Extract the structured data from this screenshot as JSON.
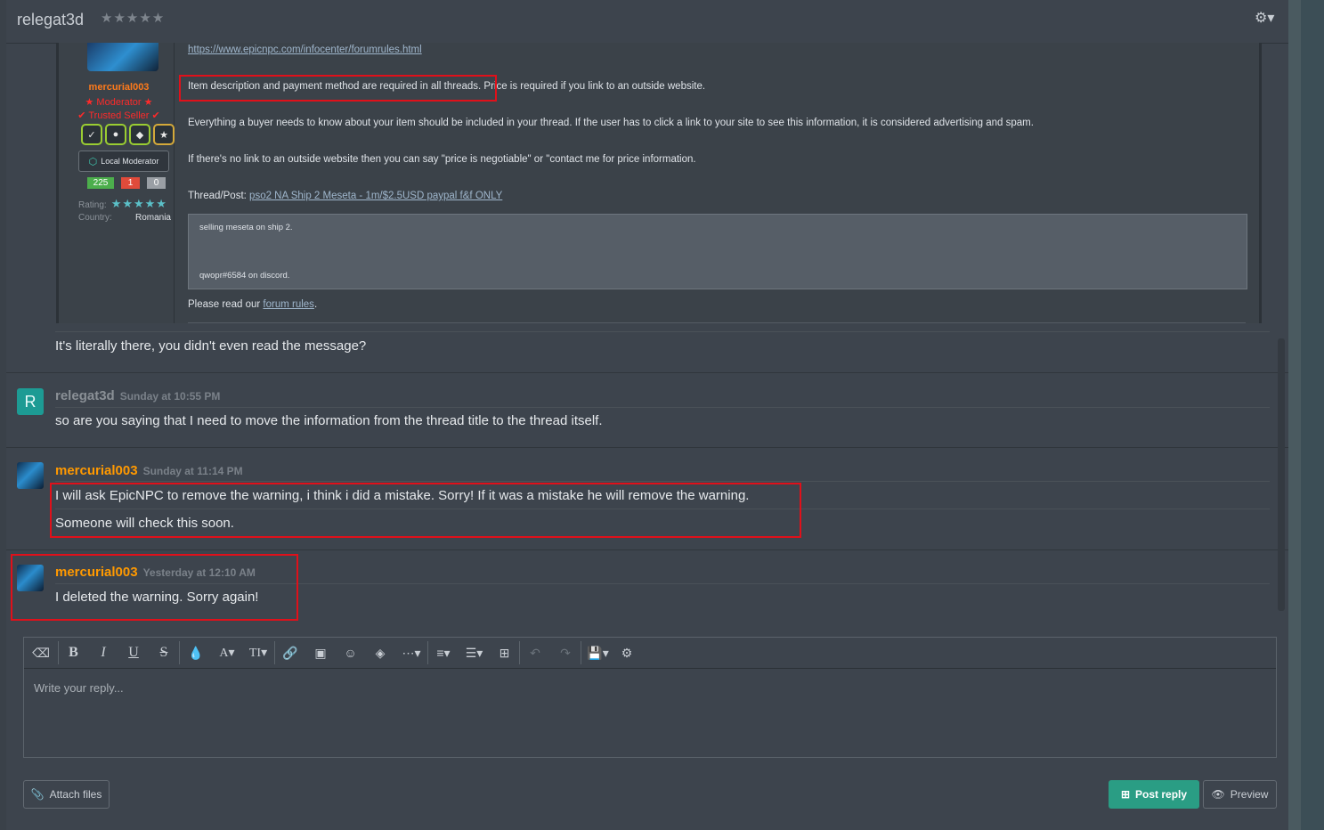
{
  "header": {
    "title": "relegat3d",
    "stars": "★★★★★",
    "gear_icon": "gear-icon"
  },
  "quote_user": {
    "name": "mercurial003",
    "role1": "★ Moderator ★",
    "role2": "✔ Trusted Seller ✔",
    "badge_text": "Local Moderator",
    "count_pos": "225",
    "count_neg": "1",
    "count_neu": "0",
    "rating_label": "Rating:",
    "rating_stars": "★★★★★",
    "country_label": "Country:",
    "country_value": "Romania"
  },
  "quote": {
    "rules_link": "https://www.epicnpc.com/infocenter/forumrules.html",
    "line1": "Item description and payment method are required in all threads. Price is required if you link to an outside website.",
    "line2": "Everything a buyer needs to know about your item should be included in your thread. If the user has to click a link to your site to see this information, it is considered advertising and spam.",
    "line3": "If there's no link to an outside website then you can say \"price is negotiable\" or \"contact me for price information.",
    "thread_label": "Thread/Post:",
    "thread_link": "pso2 NA Ship 2 Meseta - 1m/$2.5USD paypal f&f ONLY",
    "inner_quote_1": "selling meseta on ship 2.",
    "inner_quote_2": "qwopr#6584 on discord.",
    "read_prefix": "Please read our",
    "read_link": "forum rules",
    "read_suffix": "."
  },
  "reply_after_quote": "It's literally there, you didn't even read the message?",
  "posts": [
    {
      "user": "relegat3d",
      "avatar_letter": "R",
      "time": "Sunday at 10:55 PM",
      "lines": [
        "so are you saying that I need to move the information from the thread title to the thread itself."
      ]
    },
    {
      "user": "mercurial003",
      "time": "Sunday at 11:14 PM",
      "lines": [
        "I will ask EpicNPC to remove the warning, i think i did a mistake. Sorry! If it was a mistake he will remove the warning.",
        "Someone will check this soon."
      ]
    },
    {
      "user": "mercurial003",
      "time": "Yesterday at 12:10 AM",
      "lines": [
        "I deleted the warning. Sorry again!"
      ]
    }
  ],
  "editor": {
    "placeholder": "Write your reply...",
    "toolbar_icons": [
      "eraser-icon",
      "bold-icon",
      "italic-icon",
      "underline-icon",
      "strike-icon",
      "color-icon",
      "font-size-icon",
      "text-style-icon",
      "link-icon",
      "image-icon",
      "smilie-icon",
      "media-icon",
      "more-icon",
      "align-icon",
      "list-icon",
      "table-icon",
      "undo-icon",
      "redo-icon",
      "drafts-icon",
      "settings-icon"
    ]
  },
  "buttons": {
    "attach": "Attach files",
    "post": "Post reply",
    "preview": "Preview"
  },
  "colors": {
    "accent_green": "#2a9d84",
    "username_orange": "#ff9900",
    "highlight_red": "#e0101a"
  }
}
